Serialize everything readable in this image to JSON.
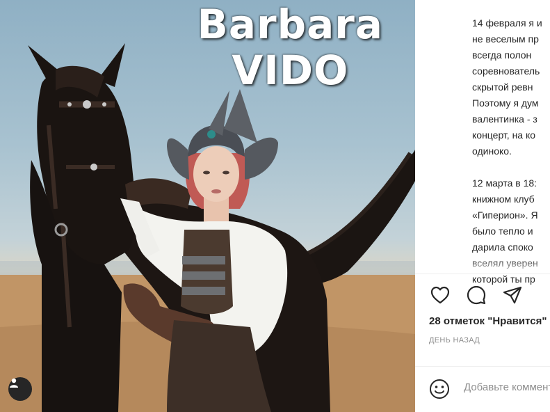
{
  "photo": {
    "title_line1": "Barbara",
    "title_line2": "VIDO",
    "user_tag_icon": "user-tag-icon"
  },
  "caption": {
    "paragraph1": [
      "14 февраля я и",
      "не веселым пр",
      "всегда полон",
      "соревнователь",
      "скрытой ревн",
      "Поэтому я дум",
      "валентинка - з",
      "концерт, на ко",
      "одиноко."
    ],
    "paragraph2": [
      "12 марта в 18:",
      "книжном клуб",
      "«Гиперион». Я",
      "было тепло и",
      "дарила споко",
      "вселял уверен",
      "которой ты пр"
    ]
  },
  "actions": {
    "like_icon": "heart-icon",
    "comment_icon": "comment-icon",
    "share_icon": "share-icon"
  },
  "likes_text": "28 отметок \"Нравится\"",
  "timestamp": "ДЕНЬ НАЗАД",
  "comment": {
    "emoji_icon": "emoji-icon",
    "placeholder": "Добавьте комментарий..."
  },
  "colors": {
    "text": "#262626",
    "secondary": "#8e8e8e",
    "divider": "#efefef",
    "tag_bg": "#262626"
  }
}
